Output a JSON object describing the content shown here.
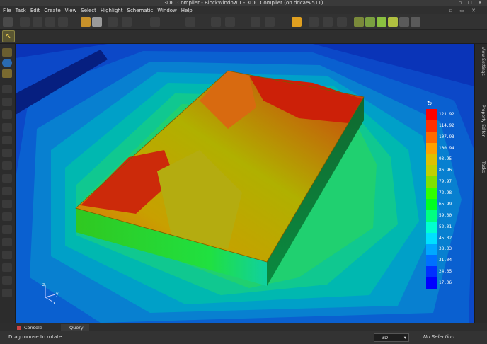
{
  "window": {
    "title": "3DIC Compiler - BlockWindow.1 - 3DIC Compiler (on ddcaev511)",
    "controls": "▫ ☐ ✕"
  },
  "menu": {
    "items": [
      "File",
      "Task",
      "Edit",
      "Create",
      "View",
      "Select",
      "Highlight",
      "Schematic",
      "Window",
      "Help"
    ],
    "window_controls": "▫ ▭ ✕"
  },
  "legend": {
    "values": [
      "121.92",
      "114.92",
      "107.93",
      "100.94",
      "93.95",
      "86.96",
      "79.97",
      "72.98",
      "65.99",
      "59.00",
      "52.01",
      "45.02",
      "38.03",
      "31.04",
      "24.05",
      "17.06"
    ],
    "colors": [
      "#ff0000",
      "#ff3000",
      "#ff6a00",
      "#ffa000",
      "#e0c000",
      "#c0d000",
      "#80e000",
      "#30ff00",
      "#00ff20",
      "#00ff80",
      "#00ffd0",
      "#00e0ff",
      "#00a8ff",
      "#0070ff",
      "#0030ff",
      "#0000ff"
    ]
  },
  "right_dock": {
    "tabs": [
      "View Settings",
      "Property Editor",
      "Tasks"
    ]
  },
  "bottom_tabs": {
    "console": "Console",
    "query": "Query"
  },
  "status": {
    "message": "Drag mouse to rotate",
    "view_mode": "3D",
    "selection": "No Selection"
  },
  "axis": {
    "x": "x",
    "y": "y",
    "z": "z"
  }
}
